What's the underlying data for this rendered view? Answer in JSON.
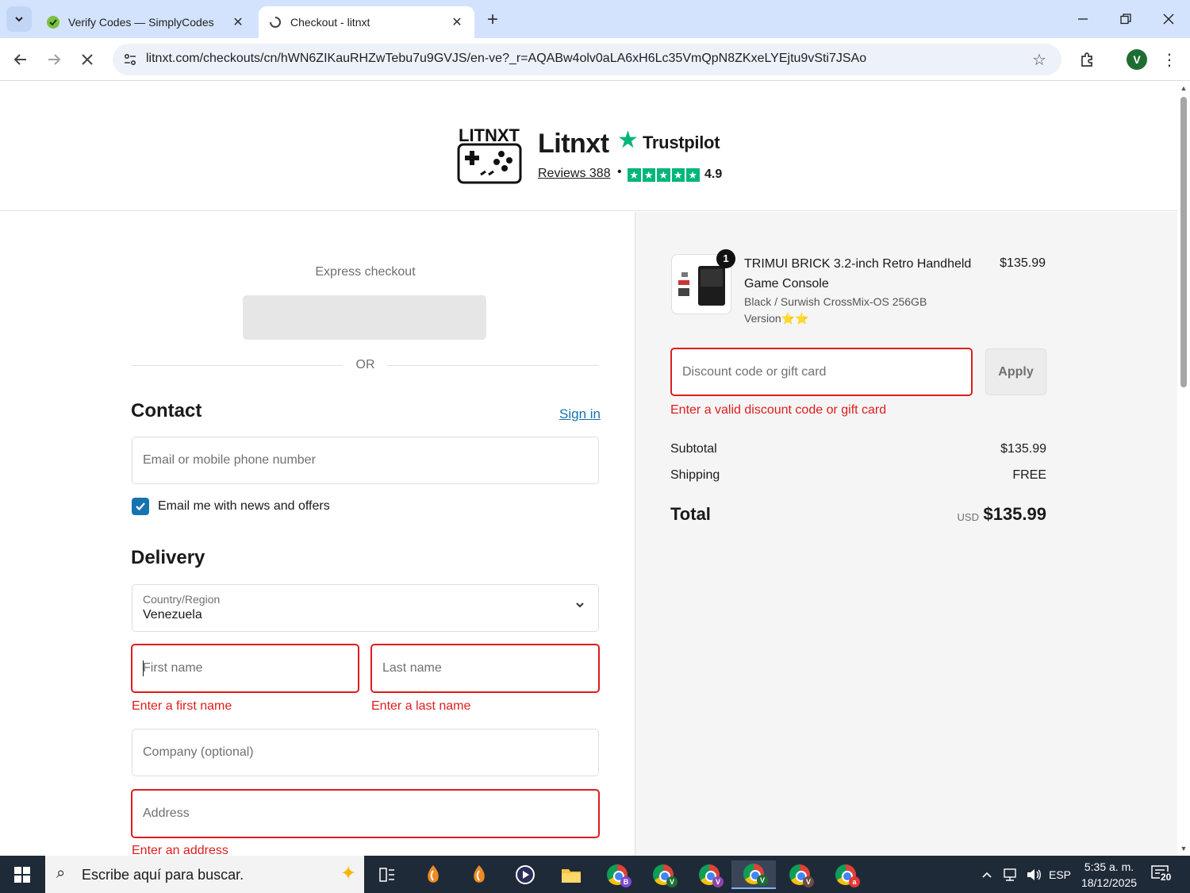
{
  "browser": {
    "tabs": [
      {
        "title": "Verify Codes — SimplyCodes",
        "active": false
      },
      {
        "title": "Checkout - litnxt",
        "active": true
      }
    ],
    "url": "litnxt.com/checkouts/cn/hWN6ZIKauRHZwTebu7u9GVJS/en-ve?_r=AQABw4olv0aLA6xH6Lc35VmQpN8ZKxeLYEjtu9vSti7JSAo",
    "profile_initial": "V"
  },
  "header": {
    "logo_text": "LITNXT",
    "brand": "Litnxt",
    "trustpilot": "Trustpilot",
    "reviews": "Reviews 388",
    "separator": "•",
    "rating": "4.9",
    "stars": 5
  },
  "checkout": {
    "express_label": "Express checkout",
    "or_label": "OR",
    "contact": {
      "heading": "Contact",
      "sign_in": "Sign in",
      "email_placeholder": "Email or mobile phone number",
      "newsletter_label": "Email me with news and offers",
      "newsletter_checked": true
    },
    "delivery": {
      "heading": "Delivery",
      "country_label": "Country/Region",
      "country_value": "Venezuela",
      "first_name_placeholder": "First name",
      "first_name_error": "Enter a first name",
      "last_name_placeholder": "Last name",
      "last_name_error": "Enter a last name",
      "company_placeholder": "Company (optional)",
      "address_placeholder": "Address",
      "address_error": "Enter an address"
    }
  },
  "summary": {
    "product": {
      "name": "TRIMUI BRICK 3.2-inch Retro Handheld Game Console",
      "variant": "Black / Surwish CrossMix-OS 256GB Version⭐⭐",
      "price": "$135.99",
      "quantity": "1"
    },
    "discount_placeholder": "Discount code or gift card",
    "apply_label": "Apply",
    "discount_error": "Enter a valid discount code or gift card",
    "subtotal_label": "Subtotal",
    "subtotal_value": "$135.99",
    "shipping_label": "Shipping",
    "shipping_value": "FREE",
    "total_label": "Total",
    "currency": "USD",
    "total_value": "$135.99"
  },
  "taskbar": {
    "search_placeholder": "Escribe aquí para buscar.",
    "language": "ESP",
    "time": "5:35 a. m.",
    "date": "18/12/2025",
    "notifications": "20",
    "chrome_badges": [
      "B",
      "V",
      "V",
      "V",
      "V",
      "a"
    ]
  },
  "colors": {
    "error": "#dd1d1d",
    "link": "#1773b0",
    "trustpilot_green": "#00b67a",
    "tabstrip": "#d3e3fd",
    "taskbar": "#1f2a38"
  }
}
